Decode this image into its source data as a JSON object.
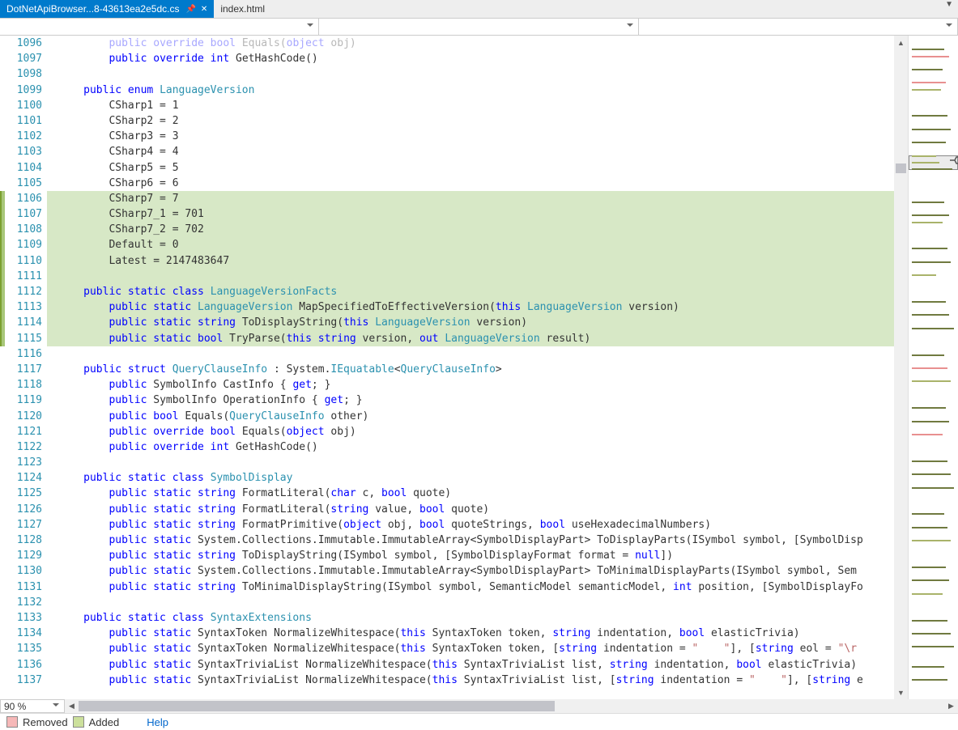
{
  "tabs": {
    "active": "DotNetApiBrowser...8-43613ea2e5dc.cs",
    "inactive": "index.html"
  },
  "zoom": "90 %",
  "status": {
    "removed": "Removed",
    "added": "Added",
    "help": "Help"
  },
  "lines": [
    {
      "n": 1096,
      "hl": false,
      "tokens": [
        {
          "t": "         ",
          "c": ""
        },
        {
          "t": "public override bool",
          "c": "kw"
        },
        {
          "t": " Equals(",
          "c": ""
        },
        {
          "t": "object",
          "c": "kw"
        },
        {
          "t": " obj)",
          "c": ""
        }
      ],
      "faded": true
    },
    {
      "n": 1097,
      "hl": false,
      "tokens": [
        {
          "t": "         ",
          "c": ""
        },
        {
          "t": "public override int",
          "c": "kw"
        },
        {
          "t": " GetHashCode()",
          "c": ""
        }
      ]
    },
    {
      "n": 1098,
      "hl": false,
      "tokens": [
        {
          "t": "",
          "c": ""
        }
      ]
    },
    {
      "n": 1099,
      "hl": false,
      "tokens": [
        {
          "t": "     ",
          "c": ""
        },
        {
          "t": "public enum",
          "c": "kw"
        },
        {
          "t": " ",
          "c": ""
        },
        {
          "t": "LanguageVersion",
          "c": "tp"
        }
      ]
    },
    {
      "n": 1100,
      "hl": false,
      "tokens": [
        {
          "t": "         CSharp1 = 1",
          "c": ""
        }
      ]
    },
    {
      "n": 1101,
      "hl": false,
      "tokens": [
        {
          "t": "         CSharp2 = 2",
          "c": ""
        }
      ]
    },
    {
      "n": 1102,
      "hl": false,
      "tokens": [
        {
          "t": "         CSharp3 = 3",
          "c": ""
        }
      ]
    },
    {
      "n": 1103,
      "hl": false,
      "tokens": [
        {
          "t": "         CSharp4 = 4",
          "c": ""
        }
      ]
    },
    {
      "n": 1104,
      "hl": false,
      "tokens": [
        {
          "t": "         CSharp5 = 5",
          "c": ""
        }
      ]
    },
    {
      "n": 1105,
      "hl": false,
      "tokens": [
        {
          "t": "         CSharp6 = 6",
          "c": ""
        }
      ]
    },
    {
      "n": 1106,
      "hl": true,
      "tokens": [
        {
          "t": "         CSharp7 = 7",
          "c": ""
        }
      ]
    },
    {
      "n": 1107,
      "hl": true,
      "tokens": [
        {
          "t": "         CSharp7_1 = 701",
          "c": ""
        }
      ]
    },
    {
      "n": 1108,
      "hl": true,
      "tokens": [
        {
          "t": "         CSharp7_2 = 702",
          "c": ""
        }
      ]
    },
    {
      "n": 1109,
      "hl": true,
      "tokens": [
        {
          "t": "         Default = 0",
          "c": ""
        }
      ]
    },
    {
      "n": 1110,
      "hl": true,
      "tokens": [
        {
          "t": "         Latest = 2147483647",
          "c": ""
        }
      ]
    },
    {
      "n": 1111,
      "hl": true,
      "tokens": [
        {
          "t": "",
          "c": ""
        }
      ]
    },
    {
      "n": 1112,
      "hl": true,
      "tokens": [
        {
          "t": "     ",
          "c": ""
        },
        {
          "t": "public static class",
          "c": "kw"
        },
        {
          "t": " ",
          "c": ""
        },
        {
          "t": "LanguageVersionFacts",
          "c": "tp"
        }
      ]
    },
    {
      "n": 1113,
      "hl": true,
      "tokens": [
        {
          "t": "         ",
          "c": ""
        },
        {
          "t": "public static",
          "c": "kw"
        },
        {
          "t": " ",
          "c": ""
        },
        {
          "t": "LanguageVersion",
          "c": "tp"
        },
        {
          "t": " MapSpecifiedToEffectiveVersion(",
          "c": ""
        },
        {
          "t": "this",
          "c": "kw"
        },
        {
          "t": " ",
          "c": ""
        },
        {
          "t": "LanguageVersion",
          "c": "tp"
        },
        {
          "t": " version)",
          "c": ""
        }
      ]
    },
    {
      "n": 1114,
      "hl": true,
      "tokens": [
        {
          "t": "         ",
          "c": ""
        },
        {
          "t": "public static string",
          "c": "kw"
        },
        {
          "t": " ToDisplayString(",
          "c": ""
        },
        {
          "t": "this",
          "c": "kw"
        },
        {
          "t": " ",
          "c": ""
        },
        {
          "t": "LanguageVersion",
          "c": "tp"
        },
        {
          "t": " version)",
          "c": ""
        }
      ]
    },
    {
      "n": 1115,
      "hl": true,
      "tokens": [
        {
          "t": "         ",
          "c": ""
        },
        {
          "t": "public static bool",
          "c": "kw"
        },
        {
          "t": " TryParse(",
          "c": ""
        },
        {
          "t": "this string",
          "c": "kw"
        },
        {
          "t": " version, ",
          "c": ""
        },
        {
          "t": "out",
          "c": "kw"
        },
        {
          "t": " ",
          "c": ""
        },
        {
          "t": "LanguageVersion",
          "c": "tp"
        },
        {
          "t": " result)",
          "c": ""
        }
      ]
    },
    {
      "n": 1116,
      "hl": false,
      "tokens": [
        {
          "t": "",
          "c": ""
        }
      ]
    },
    {
      "n": 1117,
      "hl": false,
      "tokens": [
        {
          "t": "     ",
          "c": ""
        },
        {
          "t": "public struct",
          "c": "kw"
        },
        {
          "t": " ",
          "c": ""
        },
        {
          "t": "QueryClauseInfo",
          "c": "tp"
        },
        {
          "t": " : System.",
          "c": ""
        },
        {
          "t": "IEquatable",
          "c": "tp"
        },
        {
          "t": "<",
          "c": ""
        },
        {
          "t": "QueryClauseInfo",
          "c": "tp"
        },
        {
          "t": ">",
          "c": ""
        }
      ]
    },
    {
      "n": 1118,
      "hl": false,
      "tokens": [
        {
          "t": "         ",
          "c": ""
        },
        {
          "t": "public",
          "c": "kw"
        },
        {
          "t": " SymbolInfo CastInfo { ",
          "c": ""
        },
        {
          "t": "get",
          "c": "kw"
        },
        {
          "t": "; }",
          "c": ""
        }
      ]
    },
    {
      "n": 1119,
      "hl": false,
      "tokens": [
        {
          "t": "         ",
          "c": ""
        },
        {
          "t": "public",
          "c": "kw"
        },
        {
          "t": " SymbolInfo OperationInfo { ",
          "c": ""
        },
        {
          "t": "get",
          "c": "kw"
        },
        {
          "t": "; }",
          "c": ""
        }
      ]
    },
    {
      "n": 1120,
      "hl": false,
      "tokens": [
        {
          "t": "         ",
          "c": ""
        },
        {
          "t": "public bool",
          "c": "kw"
        },
        {
          "t": " Equals(",
          "c": ""
        },
        {
          "t": "QueryClauseInfo",
          "c": "tp"
        },
        {
          "t": " other)",
          "c": ""
        }
      ]
    },
    {
      "n": 1121,
      "hl": false,
      "tokens": [
        {
          "t": "         ",
          "c": ""
        },
        {
          "t": "public override bool",
          "c": "kw"
        },
        {
          "t": " Equals(",
          "c": ""
        },
        {
          "t": "object",
          "c": "kw"
        },
        {
          "t": " obj)",
          "c": ""
        }
      ]
    },
    {
      "n": 1122,
      "hl": false,
      "tokens": [
        {
          "t": "         ",
          "c": ""
        },
        {
          "t": "public override int",
          "c": "kw"
        },
        {
          "t": " GetHashCode()",
          "c": ""
        }
      ]
    },
    {
      "n": 1123,
      "hl": false,
      "tokens": [
        {
          "t": "",
          "c": ""
        }
      ]
    },
    {
      "n": 1124,
      "hl": false,
      "tokens": [
        {
          "t": "     ",
          "c": ""
        },
        {
          "t": "public static class",
          "c": "kw"
        },
        {
          "t": " ",
          "c": ""
        },
        {
          "t": "SymbolDisplay",
          "c": "tp"
        }
      ]
    },
    {
      "n": 1125,
      "hl": false,
      "tokens": [
        {
          "t": "         ",
          "c": ""
        },
        {
          "t": "public static string",
          "c": "kw"
        },
        {
          "t": " FormatLiteral(",
          "c": ""
        },
        {
          "t": "char",
          "c": "kw"
        },
        {
          "t": " c, ",
          "c": ""
        },
        {
          "t": "bool",
          "c": "kw"
        },
        {
          "t": " quote)",
          "c": ""
        }
      ]
    },
    {
      "n": 1126,
      "hl": false,
      "tokens": [
        {
          "t": "         ",
          "c": ""
        },
        {
          "t": "public static string",
          "c": "kw"
        },
        {
          "t": " FormatLiteral(",
          "c": ""
        },
        {
          "t": "string",
          "c": "kw"
        },
        {
          "t": " value, ",
          "c": ""
        },
        {
          "t": "bool",
          "c": "kw"
        },
        {
          "t": " quote)",
          "c": ""
        }
      ]
    },
    {
      "n": 1127,
      "hl": false,
      "tokens": [
        {
          "t": "         ",
          "c": ""
        },
        {
          "t": "public static string",
          "c": "kw"
        },
        {
          "t": " FormatPrimitive(",
          "c": ""
        },
        {
          "t": "object",
          "c": "kw"
        },
        {
          "t": " obj, ",
          "c": ""
        },
        {
          "t": "bool",
          "c": "kw"
        },
        {
          "t": " quoteStrings, ",
          "c": ""
        },
        {
          "t": "bool",
          "c": "kw"
        },
        {
          "t": " useHexadecimalNumbers)",
          "c": ""
        }
      ]
    },
    {
      "n": 1128,
      "hl": false,
      "tokens": [
        {
          "t": "         ",
          "c": ""
        },
        {
          "t": "public static",
          "c": "kw"
        },
        {
          "t": " System.Collections.Immutable.ImmutableArray<SymbolDisplayPart> ToDisplayParts(ISymbol symbol, [SymbolDisp",
          "c": ""
        }
      ]
    },
    {
      "n": 1129,
      "hl": false,
      "tokens": [
        {
          "t": "         ",
          "c": ""
        },
        {
          "t": "public static string",
          "c": "kw"
        },
        {
          "t": " ToDisplayString(ISymbol symbol, [SymbolDisplayFormat format = ",
          "c": ""
        },
        {
          "t": "null",
          "c": "kw"
        },
        {
          "t": "])",
          "c": ""
        }
      ]
    },
    {
      "n": 1130,
      "hl": false,
      "tokens": [
        {
          "t": "         ",
          "c": ""
        },
        {
          "t": "public static",
          "c": "kw"
        },
        {
          "t": " System.Collections.Immutable.ImmutableArray<SymbolDisplayPart> ToMinimalDisplayParts(ISymbol symbol, Sem",
          "c": ""
        }
      ]
    },
    {
      "n": 1131,
      "hl": false,
      "tokens": [
        {
          "t": "         ",
          "c": ""
        },
        {
          "t": "public static string",
          "c": "kw"
        },
        {
          "t": " ToMinimalDisplayString(ISymbol symbol, SemanticModel semanticModel, ",
          "c": ""
        },
        {
          "t": "int",
          "c": "kw"
        },
        {
          "t": " position, [SymbolDisplayFo",
          "c": ""
        }
      ]
    },
    {
      "n": 1132,
      "hl": false,
      "tokens": [
        {
          "t": "",
          "c": ""
        }
      ]
    },
    {
      "n": 1133,
      "hl": false,
      "tokens": [
        {
          "t": "     ",
          "c": ""
        },
        {
          "t": "public static class",
          "c": "kw"
        },
        {
          "t": " ",
          "c": ""
        },
        {
          "t": "SyntaxExtensions",
          "c": "tp"
        }
      ]
    },
    {
      "n": 1134,
      "hl": false,
      "tokens": [
        {
          "t": "         ",
          "c": ""
        },
        {
          "t": "public static",
          "c": "kw"
        },
        {
          "t": " SyntaxToken NormalizeWhitespace(",
          "c": ""
        },
        {
          "t": "this",
          "c": "kw"
        },
        {
          "t": " SyntaxToken token, ",
          "c": ""
        },
        {
          "t": "string",
          "c": "kw"
        },
        {
          "t": " indentation, ",
          "c": ""
        },
        {
          "t": "bool",
          "c": "kw"
        },
        {
          "t": " elasticTrivia)",
          "c": ""
        }
      ]
    },
    {
      "n": 1135,
      "hl": false,
      "tokens": [
        {
          "t": "         ",
          "c": ""
        },
        {
          "t": "public static",
          "c": "kw"
        },
        {
          "t": " SyntaxToken NormalizeWhitespace(",
          "c": ""
        },
        {
          "t": "this",
          "c": "kw"
        },
        {
          "t": " SyntaxToken token, [",
          "c": ""
        },
        {
          "t": "string",
          "c": "kw"
        },
        {
          "t": " indentation = ",
          "c": ""
        },
        {
          "t": "\"    \"",
          "c": "str"
        },
        {
          "t": "], [",
          "c": ""
        },
        {
          "t": "string",
          "c": "kw"
        },
        {
          "t": " eol = ",
          "c": ""
        },
        {
          "t": "\"\\r",
          "c": "str"
        }
      ]
    },
    {
      "n": 1136,
      "hl": false,
      "tokens": [
        {
          "t": "         ",
          "c": ""
        },
        {
          "t": "public static",
          "c": "kw"
        },
        {
          "t": " SyntaxTriviaList NormalizeWhitespace(",
          "c": ""
        },
        {
          "t": "this",
          "c": "kw"
        },
        {
          "t": " SyntaxTriviaList list, ",
          "c": ""
        },
        {
          "t": "string",
          "c": "kw"
        },
        {
          "t": " indentation, ",
          "c": ""
        },
        {
          "t": "bool",
          "c": "kw"
        },
        {
          "t": " elasticTrivia)",
          "c": ""
        }
      ]
    },
    {
      "n": 1137,
      "hl": false,
      "tokens": [
        {
          "t": "         ",
          "c": ""
        },
        {
          "t": "public static",
          "c": "kw"
        },
        {
          "t": " SyntaxTriviaList NormalizeWhitespace(",
          "c": ""
        },
        {
          "t": "this",
          "c": "kw"
        },
        {
          "t": " SyntaxTriviaList list, [",
          "c": ""
        },
        {
          "t": "string",
          "c": "kw"
        },
        {
          "t": " indentation = ",
          "c": ""
        },
        {
          "t": "\"    \"",
          "c": "str"
        },
        {
          "t": "], [",
          "c": ""
        },
        {
          "t": "string",
          "c": "kw"
        },
        {
          "t": " e",
          "c": ""
        }
      ]
    }
  ]
}
